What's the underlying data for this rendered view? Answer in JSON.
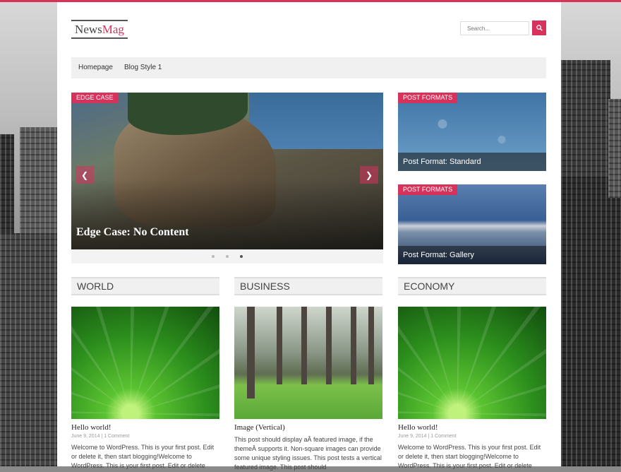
{
  "brand": {
    "part1": "News",
    "part2": "Mag",
    "accent": "#d6325c"
  },
  "search": {
    "placeholder": "Search..."
  },
  "nav": {
    "items": [
      {
        "label": "Homepage"
      },
      {
        "label": "Blog Style 1"
      }
    ]
  },
  "slider": {
    "label": "EDGE CASE",
    "title": "Edge Case: No Content",
    "active_dot": 3
  },
  "side_posts": [
    {
      "label": "POST FORMATS",
      "title": "Post Format: Standard"
    },
    {
      "label": "POST FORMATS",
      "title": "Post Format: Gallery"
    }
  ],
  "columns": [
    {
      "category": "WORLD",
      "title": "Hello world!",
      "date": "June 9, 2014",
      "comments": "1 Comment",
      "excerpt": "Welcome to WordPress. This is your first post. Edit or delete it, then start blogging!Welcome to WordPress. This is your first post. Edit or delete"
    },
    {
      "category": "BUSINESS",
      "title": "Image (Vertical)",
      "date": "June 9, 2014",
      "comments": "1 Comment",
      "excerpt": "This post should display aÂ featured image, if the themeÂ supports it. Non-square images can provide some unique styling issues. This post tests a vertical featured image. This post should"
    },
    {
      "category": "ECONOMY",
      "title": "Hello world!",
      "date": "June 9, 2014",
      "comments": "1 Comment",
      "excerpt": "Welcome to WordPress. This is your first post. Edit or delete it, then start blogging!Welcome to WordPress. This is your first post. Edit or delete"
    }
  ]
}
